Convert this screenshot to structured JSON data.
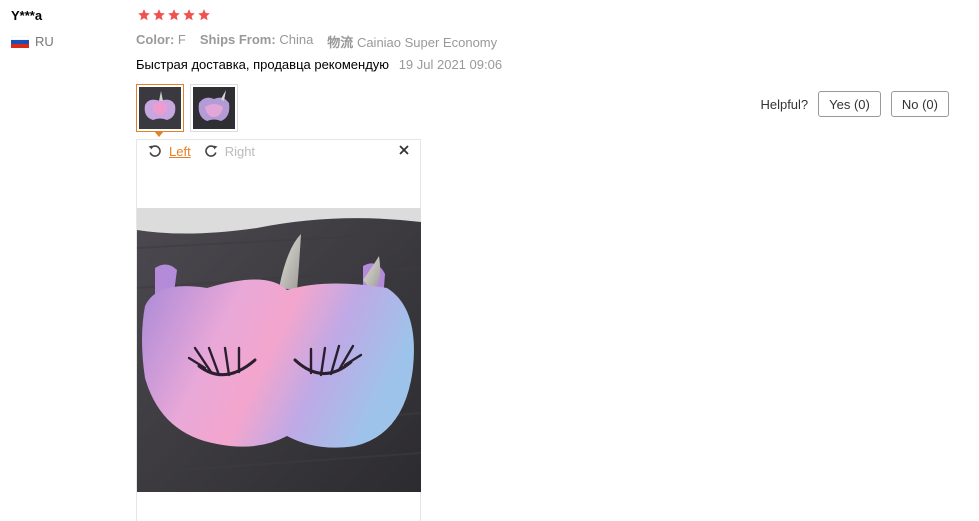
{
  "user": {
    "name": "Y***a",
    "country": "RU",
    "flag_icon": "flag-russia-icon"
  },
  "review": {
    "rating": 5,
    "star_color": "#ef5350",
    "attributes": [
      {
        "key": "Color:",
        "value": "F"
      },
      {
        "key": "Ships From:",
        "value": "China"
      },
      {
        "key": "物流",
        "value": "Cainiao Super Economy"
      }
    ],
    "text": "Быстрая доставка, продавца рекомендую",
    "date": "19 Jul 2021 09:06",
    "thumbnails": [
      "review-photo-1",
      "review-photo-2"
    ]
  },
  "helpful": {
    "label": "Helpful?",
    "yes_label": "Yes (0)",
    "no_label": "No (0)"
  },
  "viewer": {
    "rotate_left_label": "Left",
    "rotate_right_label": "Right",
    "accent_color": "#e48127"
  }
}
